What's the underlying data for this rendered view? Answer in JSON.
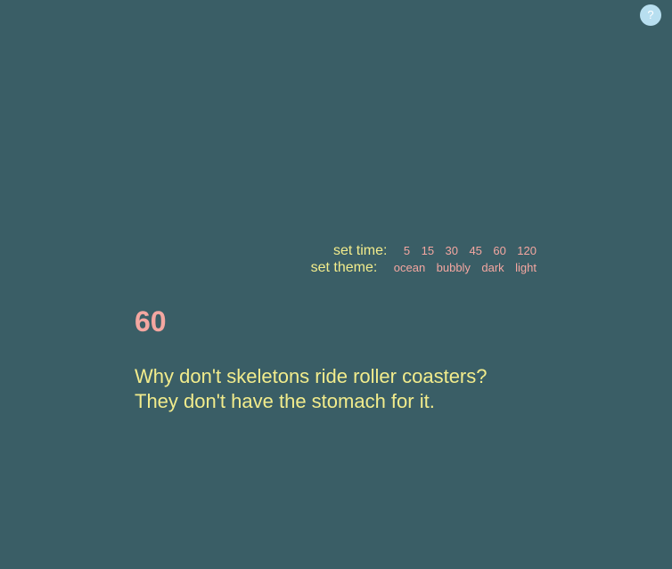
{
  "help": {
    "label": "?"
  },
  "settings": {
    "time_label": "set time:",
    "time_options": [
      "5",
      "15",
      "30",
      "45",
      "60",
      "120"
    ],
    "theme_label": "set theme:",
    "theme_options": [
      "ocean",
      "bubbly",
      "dark",
      "light"
    ]
  },
  "timer": {
    "value": "60"
  },
  "text": {
    "lines": [
      "Why don't skeletons ride roller coasters?",
      "They don't have the stomach for it."
    ]
  },
  "colors": {
    "background": "#3a5e66",
    "primary_text": "#f2ec8c",
    "accent": "#f4a7a1",
    "help_button": "#b8dff0"
  }
}
